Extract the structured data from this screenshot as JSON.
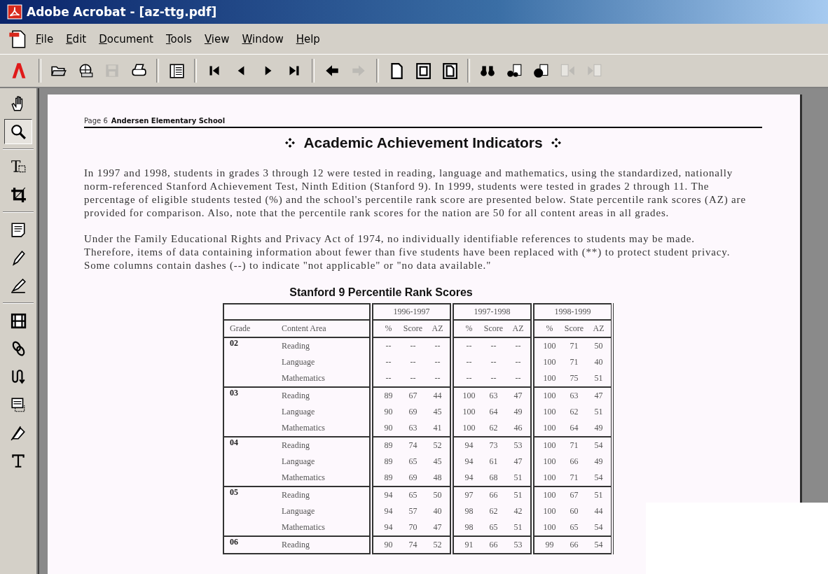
{
  "window": {
    "title": "Adobe Acrobat - [az-ttg.pdf]"
  },
  "menu": [
    "File",
    "Edit",
    "Document",
    "Tools",
    "View",
    "Window",
    "Help"
  ],
  "toolbar": [
    {
      "disabled": false
    },
    {
      "disabled": false
    },
    {
      "disabled": true
    },
    {
      "disabled": false
    },
    {
      "disabled": false
    },
    {
      "disabled": false
    },
    {
      "disabled": false
    },
    {
      "disabled": false
    },
    {
      "disabled": false
    },
    {
      "disabled": false
    },
    {
      "disabled": true
    },
    {
      "disabled": false
    },
    {
      "disabled": false
    },
    {
      "disabled": false
    },
    {
      "disabled": false
    },
    {
      "disabled": false
    },
    {
      "disabled": false
    },
    {
      "disabled": true
    },
    {
      "disabled": true
    }
  ],
  "tools": [
    {
      "selected": false
    },
    {
      "selected": true
    },
    {
      "selected": false
    },
    {
      "selected": false
    },
    {
      "selected": false
    },
    {
      "selected": false
    },
    {
      "selected": false
    },
    {
      "selected": false
    },
    {
      "selected": false
    },
    {
      "selected": false
    },
    {
      "selected": false
    },
    {
      "selected": false
    },
    {
      "selected": false
    }
  ],
  "page": {
    "header_page": "Page 6",
    "header_school": "Andersen Elementary School",
    "heading": "Academic Achievement Indicators",
    "paragraphs": [
      "In 1997 and 1998, students in grades 3 through 12 were tested in reading, language and mathematics, using the standardized, nationally norm-referenced Stanford Achievement Test, Ninth Edition (Stanford 9). In 1999, students were tested in grades 2 through 11. The percentage of eligible students tested (%) and the school's percentile rank score are presented below. State percentile rank scores (AZ) are provided for comparison. Also, note that the percentile rank scores for the nation are 50 for all content areas in all grades.",
      "Under the Family Educational Rights and Privacy Act of 1974, no individually identifiable references to students may be made. Therefore, items of data containing information about fewer than five students have been replaced with (**) to protect student privacy. Some columns contain dashes (--) to indicate \"not applicable\" or \"no data available.\""
    ],
    "table": {
      "title": "Stanford 9 Percentile Rank Scores",
      "columns": [
        "Grade",
        "Content Area"
      ],
      "year_groups": [
        {
          "label": "1996-1997",
          "columns": [
            "%",
            "Score",
            "AZ"
          ]
        },
        {
          "label": "1997-1998",
          "columns": [
            "%",
            "Score",
            "AZ"
          ]
        },
        {
          "label": "1998-1999",
          "columns": [
            "%",
            "Score",
            "AZ"
          ]
        }
      ],
      "grades": [
        {
          "grade": "02",
          "rows": [
            {
              "area": "Reading",
              "values": [
                "--",
                "--",
                "--",
                "--",
                "--",
                "--",
                "100",
                "71",
                "50"
              ]
            },
            {
              "area": "Language",
              "values": [
                "--",
                "--",
                "--",
                "--",
                "--",
                "--",
                "100",
                "71",
                "40"
              ]
            },
            {
              "area": "Mathematics",
              "values": [
                "--",
                "--",
                "--",
                "--",
                "--",
                "--",
                "100",
                "75",
                "51"
              ]
            }
          ]
        },
        {
          "grade": "03",
          "rows": [
            {
              "area": "Reading",
              "values": [
                "89",
                "67",
                "44",
                "100",
                "63",
                "47",
                "100",
                "63",
                "47"
              ]
            },
            {
              "area": "Language",
              "values": [
                "90",
                "69",
                "45",
                "100",
                "64",
                "49",
                "100",
                "62",
                "51"
              ]
            },
            {
              "area": "Mathematics",
              "values": [
                "90",
                "63",
                "41",
                "100",
                "62",
                "46",
                "100",
                "64",
                "49"
              ]
            }
          ]
        },
        {
          "grade": "04",
          "rows": [
            {
              "area": "Reading",
              "values": [
                "89",
                "74",
                "52",
                "94",
                "73",
                "53",
                "100",
                "71",
                "54"
              ]
            },
            {
              "area": "Language",
              "values": [
                "89",
                "65",
                "45",
                "94",
                "61",
                "47",
                "100",
                "66",
                "49"
              ]
            },
            {
              "area": "Mathematics",
              "values": [
                "89",
                "69",
                "48",
                "94",
                "68",
                "51",
                "100",
                "71",
                "54"
              ]
            }
          ]
        },
        {
          "grade": "05",
          "rows": [
            {
              "area": "Reading",
              "values": [
                "94",
                "65",
                "50",
                "97",
                "66",
                "51",
                "100",
                "67",
                "51"
              ]
            },
            {
              "area": "Language",
              "values": [
                "94",
                "57",
                "40",
                "98",
                "62",
                "42",
                "100",
                "60",
                "44"
              ]
            },
            {
              "area": "Mathematics",
              "values": [
                "94",
                "70",
                "47",
                "98",
                "65",
                "51",
                "100",
                "65",
                "54"
              ]
            }
          ]
        },
        {
          "grade": "06",
          "rows": [
            {
              "area": "Reading",
              "values": [
                "90",
                "74",
                "52",
                "91",
                "66",
                "53",
                "99",
                "66",
                "54"
              ]
            }
          ]
        }
      ]
    }
  }
}
